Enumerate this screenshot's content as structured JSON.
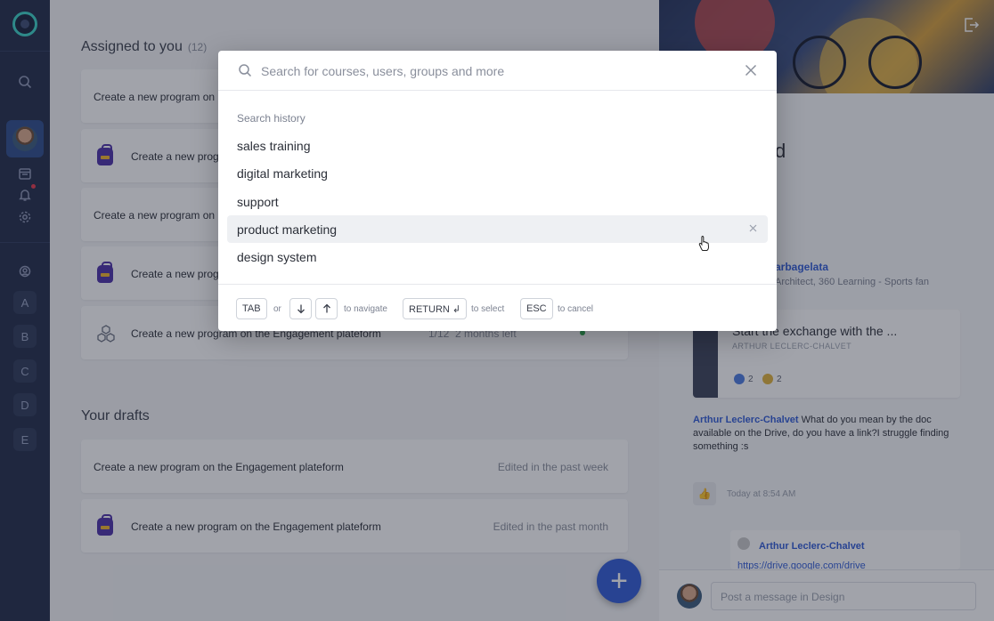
{
  "sidebar": {
    "spaces": [
      "A",
      "B",
      "C",
      "D",
      "E"
    ]
  },
  "main": {
    "assigned": {
      "title": "Assigned to you",
      "count": "(12)",
      "items": [
        {
          "label": "Create a new program on"
        },
        {
          "label": "Create a new prog"
        },
        {
          "label": "Create a new program on"
        },
        {
          "label": "Create a new prog"
        },
        {
          "label": "Create a new program on the Engagement plateform",
          "progress": "1/12",
          "deadline": "2 months left"
        }
      ]
    },
    "drafts": {
      "title": "Your drafts",
      "items": [
        {
          "label": "Create a new program on the Engagement plateform",
          "meta": "Edited in the past week"
        },
        {
          "label": "Create a new program on the Engagement plateform",
          "meta": "Edited in the past month"
        }
      ]
    },
    "fab_label": "+"
  },
  "right_panel": {
    "title_fragment": "d",
    "author_fragment": "arbagelata",
    "subtitle_fragment": "Architect, 360 Learning - Sports fan",
    "post": {
      "title": "Start the exchange with the ...",
      "author": "ARTHUR LECLERC-CHALVET",
      "reaction_counts": [
        "2",
        "2"
      ]
    },
    "comment": {
      "author": "Arthur Leclerc-Chalvet",
      "text": " What do you mean by the doc available on the Drive, do you have a link?I struggle finding something :s"
    },
    "timestamp": "Today at 8:54 AM",
    "reply": {
      "author": "Arthur Leclerc-Chalvet",
      "link": "https://drive.google.com/drive"
    },
    "composer_placeholder": "Post a message in Design"
  },
  "search_modal": {
    "placeholder": "Search for courses, users, groups and more",
    "history_label": "Search history",
    "history": [
      "sales training",
      "digital marketing",
      "support",
      "product marketing",
      "design system"
    ],
    "hovered_index": 3,
    "shortcuts": {
      "tab_key": "TAB",
      "or": "or",
      "navigate": "to navigate",
      "return_key": "RETURN ↲",
      "select": "to select",
      "esc_key": "ESC",
      "cancel": "to cancel"
    }
  }
}
